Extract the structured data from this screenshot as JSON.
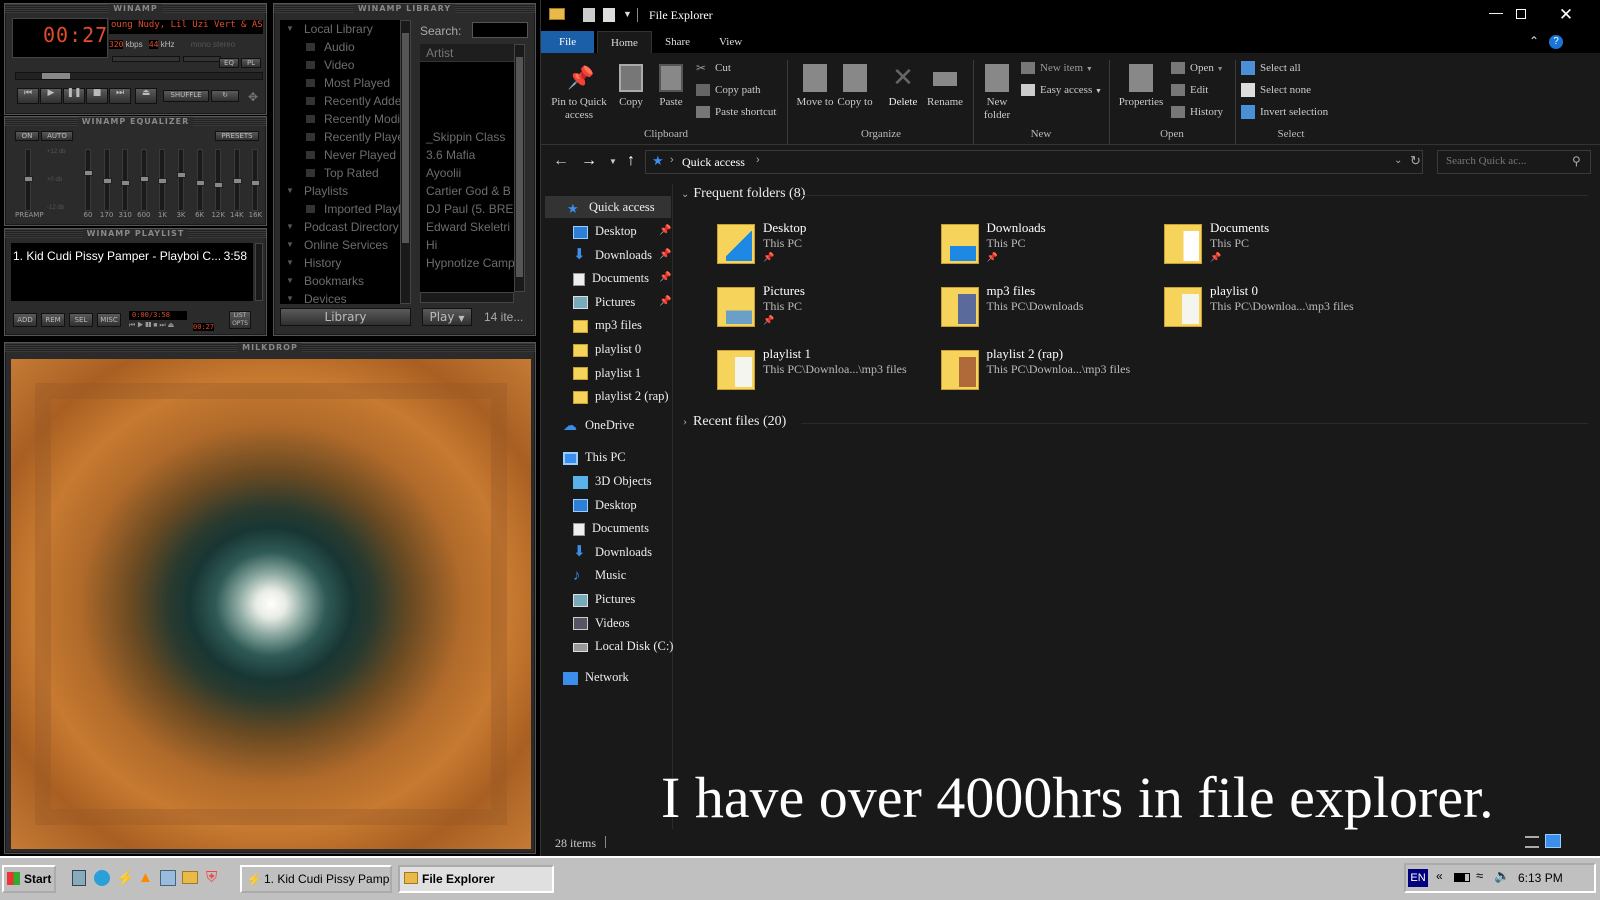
{
  "winamp": {
    "main_title": "WINAMP",
    "time": "00:27",
    "ticker": "oung Nudy, Lil Uzi Vert & ASAP R",
    "kbps": "320",
    "kbps_label": "kbps",
    "khz": "44",
    "khz_label": "kHz",
    "mono": "mono",
    "stereo": "stereo",
    "shuffle": "SHUFFLE",
    "eq_btn": "EQ",
    "pl_btn": "PL",
    "eq_title": "WINAMP EQUALIZER",
    "eq_on": "ON",
    "eq_auto": "AUTO",
    "eq_presets": "PRESETS",
    "eq_preamp": "PREAMP",
    "eq_db_top": "+12 db",
    "eq_db_mid": "+0 db",
    "eq_db_bot": "-12 db",
    "eq_bands": [
      "60",
      "170",
      "310",
      "600",
      "1K",
      "3K",
      "6K",
      "12K",
      "14K",
      "16K"
    ],
    "playlist_title": "WINAMP PLAYLIST",
    "playlist_entry": "1. Kid Cudi Pissy Pamper - Playboi C...",
    "playlist_duration": "3:58",
    "pl_buttons": [
      "ADD",
      "REM",
      "SEL",
      "MISC"
    ],
    "pl_list": "LIST OPTS",
    "pl_time": "0:00/3:58",
    "pl_time2": "00:27",
    "library_title": "WINAMP LIBRARY",
    "search_label": "Search:",
    "artist_header": "Artist",
    "library_tree": [
      {
        "label": "Local Library",
        "top": true
      },
      {
        "label": "Audio"
      },
      {
        "label": "Video"
      },
      {
        "label": "Most Played"
      },
      {
        "label": "Recently Added"
      },
      {
        "label": "Recently Modified"
      },
      {
        "label": "Recently Played"
      },
      {
        "label": "Never Played"
      },
      {
        "label": "Top Rated"
      },
      {
        "label": "Playlists",
        "top": true
      },
      {
        "label": "Imported Playlists"
      },
      {
        "label": "Podcast Directory",
        "top": true
      },
      {
        "label": "Online Services",
        "top": true
      },
      {
        "label": "History",
        "top": true
      },
      {
        "label": "Bookmarks",
        "top": true
      },
      {
        "label": "Devices",
        "top": true
      }
    ],
    "artists": [
      "_Skippin Class",
      "3.6 Mafia",
      "Ayoolii",
      "Cartier God & B",
      "DJ Paul (5. BRE",
      "Edward Skeletri",
      "Hi",
      "Hypnotize Camp"
    ],
    "library_button": "Library",
    "play_button": "Play",
    "item_count": "14 ite...",
    "milkdrop_title": "MILKDROP"
  },
  "explorer": {
    "title": "File Explorer",
    "tabs": [
      "File",
      "Home",
      "Share",
      "View"
    ],
    "ribbon": {
      "pin": "Pin to Quick access",
      "copy": "Copy",
      "paste": "Paste",
      "cut": "Cut",
      "copy_path": "Copy path",
      "paste_shortcut": "Paste shortcut",
      "clipboard": "Clipboard",
      "move_to": "Move to",
      "copy_to": "Copy to",
      "delete": "Delete",
      "rename": "Rename",
      "organize": "Organize",
      "new_folder": "New folder",
      "new_item": "New item",
      "easy_access": "Easy access",
      "new": "New",
      "properties": "Properties",
      "open": "Open",
      "edit": "Edit",
      "history": "History",
      "open_group": "Open",
      "select_all": "Select all",
      "select_none": "Select none",
      "invert_selection": "Invert selection",
      "select_group": "Select"
    },
    "address": "Quick access",
    "search_placeholder": "Search Quick ac...",
    "nav": {
      "quick_access": "Quick access",
      "quick_items": [
        {
          "label": "Desktop",
          "pinned": true,
          "icon": "desktop-icon"
        },
        {
          "label": "Downloads",
          "pinned": true,
          "icon": "download-arrow-icon"
        },
        {
          "label": "Documents",
          "pinned": true,
          "icon": "document-icon"
        },
        {
          "label": "Pictures",
          "pinned": true,
          "icon": "picture-icon"
        },
        {
          "label": "mp3 files",
          "pinned": false,
          "icon": "folder-icon"
        },
        {
          "label": "playlist 0",
          "pinned": false,
          "icon": "folder-icon"
        },
        {
          "label": "playlist 1",
          "pinned": false,
          "icon": "folder-icon"
        },
        {
          "label": "playlist 2 (rap)",
          "pinned": false,
          "icon": "folder-icon"
        }
      ],
      "onedrive": "OneDrive",
      "this_pc": "This PC",
      "pc_items": [
        "3D Objects",
        "Desktop",
        "Documents",
        "Downloads",
        "Music",
        "Pictures",
        "Videos",
        "Local Disk (C:)"
      ],
      "network": "Network"
    },
    "frequent_header": "Frequent folders (8)",
    "folders": [
      {
        "name": "Desktop",
        "path": "This PC",
        "pinned": true
      },
      {
        "name": "Downloads",
        "path": "This PC",
        "pinned": true
      },
      {
        "name": "Documents",
        "path": "This PC",
        "pinned": true
      },
      {
        "name": "Pictures",
        "path": "This PC",
        "pinned": true
      },
      {
        "name": "mp3 files",
        "path": "This PC\\Downloads",
        "pinned": false
      },
      {
        "name": "playlist 0",
        "path": "This PC\\Downloa...\\mp3 files",
        "pinned": false
      },
      {
        "name": "playlist 1",
        "path": "This PC\\Downloa...\\mp3 files",
        "pinned": false
      },
      {
        "name": "playlist 2 (rap)",
        "path": "This PC\\Downloa...\\mp3 files",
        "pinned": false
      }
    ],
    "recent_header": "Recent files (20)",
    "status": "28 items",
    "caption": "I have over 4000hrs in file explorer."
  },
  "taskbar": {
    "start": "Start",
    "tasks": [
      "1. Kid Cudi Pissy Pamper ...",
      "File Explorer"
    ],
    "lang": "EN",
    "clock": "6:13 PM"
  },
  "colors": {
    "lcd_red": "#e34c2b",
    "accent": "#0078d7",
    "folder_yellow": "#f6d35a"
  }
}
